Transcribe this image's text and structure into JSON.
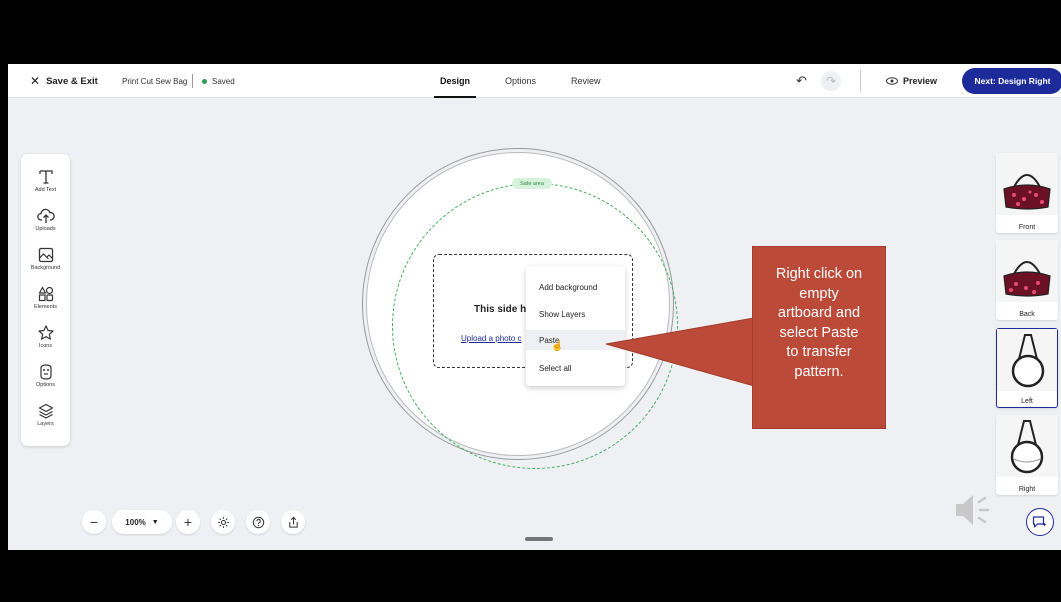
{
  "topbar": {
    "save_exit": "Save & Exit",
    "project_name": "Print Cut Sew Bag",
    "saved_status": "Saved",
    "tabs": [
      "Design",
      "Options",
      "Review"
    ],
    "active_tab": "Design",
    "preview_label": "Preview",
    "next_button": "Next: Design Right"
  },
  "left_toolbar": {
    "items": [
      {
        "label": "Add Text",
        "icon": "text-icon"
      },
      {
        "label": "Uploads",
        "icon": "upload-cloud-icon"
      },
      {
        "label": "Background",
        "icon": "background-icon"
      },
      {
        "label": "Elements",
        "icon": "shapes-icon"
      },
      {
        "label": "Icons",
        "icon": "star-icon"
      },
      {
        "label": "Options",
        "icon": "options-icon"
      },
      {
        "label": "Layers",
        "icon": "layers-icon"
      }
    ]
  },
  "canvas": {
    "safe_area_label": "Safe area",
    "side_text": "This side h",
    "upload_link": "Upload a photo c"
  },
  "context_menu": {
    "items": [
      "Add background",
      "Show Layers",
      "Paste",
      "Select all"
    ],
    "hovered": "Paste"
  },
  "callout": {
    "lines": [
      "Right click on",
      "empty",
      "artboard and",
      "select Paste",
      "to transfer",
      "pattern."
    ],
    "color": "#bc4a39"
  },
  "thumbnails": [
    {
      "label": "Front",
      "selected": false
    },
    {
      "label": "Back",
      "selected": false
    },
    {
      "label": "Left",
      "selected": true
    },
    {
      "label": "Right",
      "selected": false
    }
  ],
  "bottom_bar": {
    "zoom_level": "100%"
  },
  "colors": {
    "accent": "#1d2b9a",
    "saved_dot": "#2e9e4f",
    "safe_area": "#3fae5a"
  }
}
